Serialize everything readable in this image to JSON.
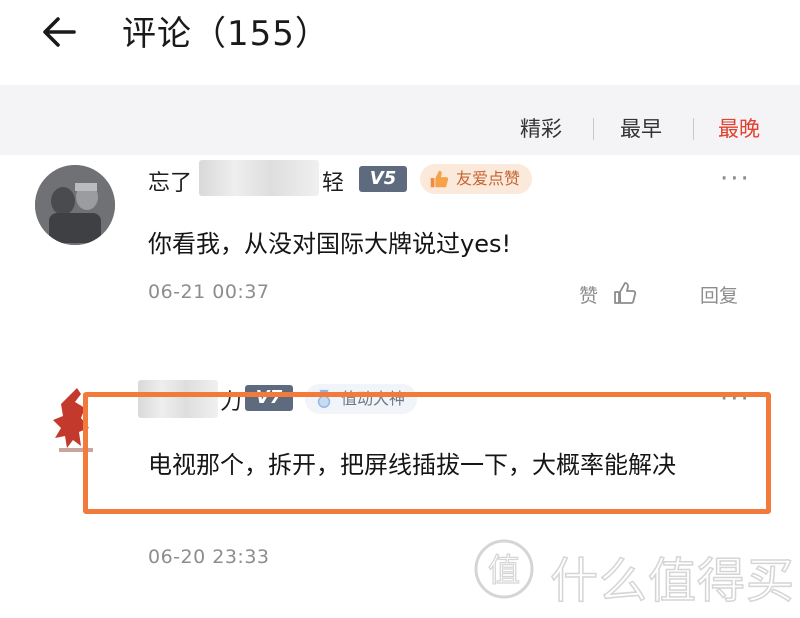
{
  "header": {
    "title": "评论（155）"
  },
  "sort_tabs": [
    {
      "label": "精彩",
      "active": false
    },
    {
      "label": "最早",
      "active": false
    },
    {
      "label": "最晚",
      "active": true
    }
  ],
  "accent_color": "#e1412f",
  "highlight_color": "#f27a3a",
  "comments": [
    {
      "username_prefix": "忘了",
      "username_suffix": "轻",
      "level_badge": "V5",
      "honor_badge": "友爱点赞",
      "text": "你看我，从没对国际大牌说过yes!",
      "time": "06-21 00:37",
      "like_label": "赞",
      "reply_label": "回复"
    },
    {
      "username_suffix": "力",
      "level_badge": "V7",
      "honor_badge": "值动大神",
      "text": "电视那个，拆开，把屏线插拔一下，大概率能解决",
      "time": "06-20 23:33"
    }
  ],
  "watermark": {
    "text": "什么值得买",
    "icon_char": "值"
  }
}
